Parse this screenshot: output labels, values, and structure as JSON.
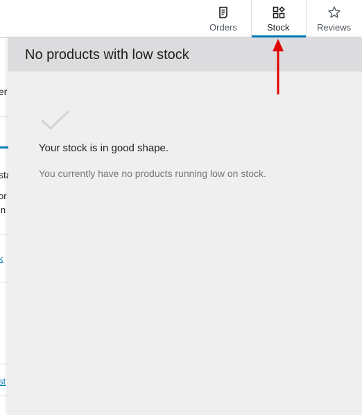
{
  "topbar": {
    "tabs": [
      {
        "label": "Orders",
        "icon": "orders-page-icon",
        "active": false
      },
      {
        "label": "Stock",
        "icon": "stock-grid-icon",
        "active": true
      },
      {
        "label": "Reviews",
        "icon": "star-icon",
        "active": false
      }
    ]
  },
  "panel": {
    "title": "No products with low stock",
    "empty_state": {
      "icon": "checkmark-icon",
      "heading": "Your stock is in good shape.",
      "message": "You currently have no products running low on stock."
    }
  },
  "background_page": {
    "fragments": [
      "er",
      "sta",
      "or",
      "in",
      "k",
      "st"
    ]
  },
  "colors": {
    "accent": "#007cba",
    "annotation": "#e00000",
    "panel_bg": "#efefef",
    "header_bg": "#dcdcde"
  }
}
